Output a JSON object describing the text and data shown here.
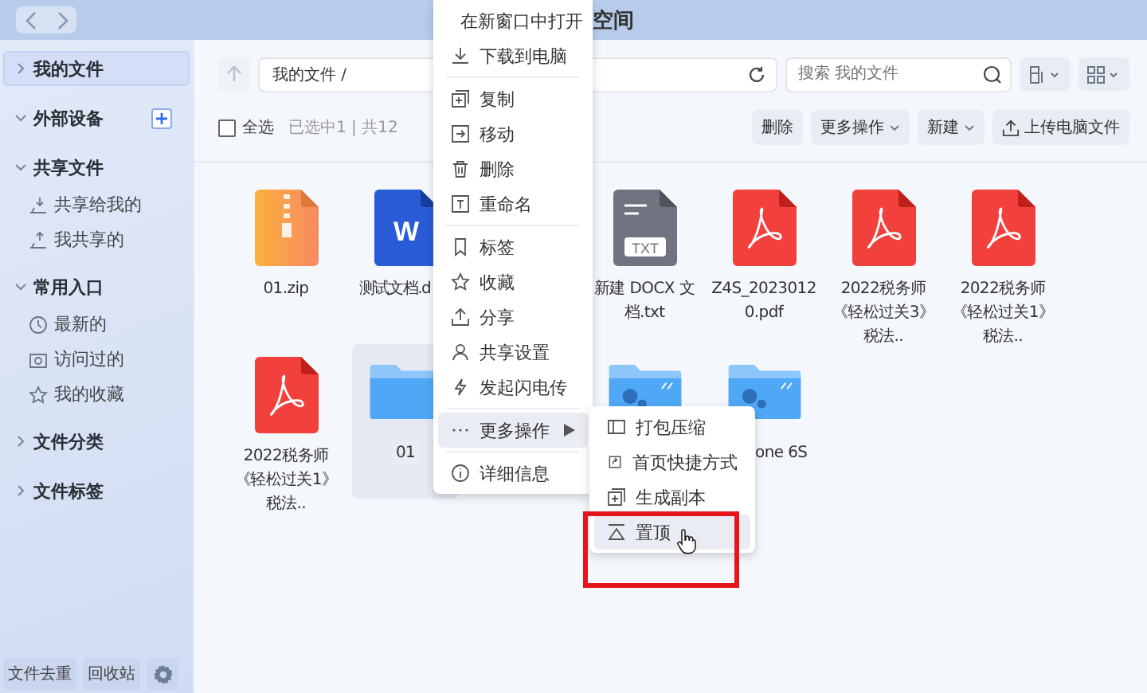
{
  "window": {
    "title": "空间"
  },
  "sidebar": {
    "sections": [
      {
        "label": "我的文件",
        "expanded": false,
        "selected": true
      },
      {
        "label": "外部设备",
        "expanded": true,
        "selected": false,
        "add_button": true
      },
      {
        "label": "共享文件",
        "expanded": true,
        "selected": false,
        "children": [
          {
            "label": "共享给我的"
          },
          {
            "label": "我共享的"
          }
        ]
      },
      {
        "label": "常用入口",
        "expanded": true,
        "selected": false,
        "children": [
          {
            "label": "最新的"
          },
          {
            "label": "访问过的"
          },
          {
            "label": "我的收藏"
          }
        ]
      },
      {
        "label": "文件分类",
        "expanded": false,
        "selected": false
      },
      {
        "label": "文件标签",
        "expanded": false,
        "selected": false
      }
    ],
    "footer_buttons": [
      "文件去重",
      "回收站"
    ]
  },
  "toolbar": {
    "path": "我的文件 /",
    "search": {
      "placeholder": "搜索 我的文件"
    }
  },
  "actions": {
    "select_all": {
      "label": "全选",
      "checked": false
    },
    "status": "已选中1 | 共12",
    "buttons": [
      {
        "kind": "plain",
        "label": "删除"
      },
      {
        "kind": "dropdown",
        "label": "更多操作"
      },
      {
        "kind": "dropdown",
        "label": "新建"
      },
      {
        "kind": "upload",
        "label": "上传电脑文件"
      }
    ]
  },
  "files": [
    [
      {
        "kind": "zip",
        "name": "01.zip",
        "selected": false
      },
      {
        "kind": "word",
        "icon_text": "W",
        "name": "测试文档.d",
        "selected": false
      },
      {
        "kind": "txt",
        "icon_text": "TXT",
        "name": "新建 DOCX 文档.txt",
        "selected": false
      },
      {
        "kind": "pdf",
        "name": "Z4S_20230120.pdf",
        "selected": false
      },
      {
        "kind": "pdf",
        "name": "2022税务师《轻松过关3》税法..",
        "selected": false
      },
      {
        "kind": "pdf",
        "name": "2022税务师《轻松过关1》税法..",
        "selected": false
      }
    ],
    [
      {
        "kind": "pdf",
        "name": "2022税务师《轻松过关1》税法..",
        "selected": false
      },
      {
        "kind": "folder",
        "name": "01",
        "selected": true
      },
      {
        "kind": "folder-gear",
        "selected": false
      },
      {
        "kind": "folder-gear",
        "name": "one 6S",
        "selected": false
      }
    ]
  ],
  "context_menu": [
    {
      "kind": "item",
      "label": "在新窗口中打开",
      "highlighted": false
    },
    {
      "kind": "item",
      "label": "下载到电脑",
      "highlighted": false
    },
    {
      "kind": "divider"
    },
    {
      "kind": "item",
      "label": "复制",
      "highlighted": false
    },
    {
      "kind": "item",
      "label": "移动",
      "highlighted": false
    },
    {
      "kind": "item",
      "label": "删除",
      "highlighted": false
    },
    {
      "kind": "item",
      "label": "重命名",
      "highlighted": false
    },
    {
      "kind": "divider"
    },
    {
      "kind": "item",
      "label": "标签",
      "highlighted": false
    },
    {
      "kind": "item",
      "label": "收藏",
      "highlighted": false
    },
    {
      "kind": "item",
      "label": "分享",
      "highlighted": false
    },
    {
      "kind": "item",
      "label": "共享设置",
      "highlighted": false
    },
    {
      "kind": "item",
      "label": "发起闪电传",
      "highlighted": false
    },
    {
      "kind": "divider"
    },
    {
      "kind": "submenu",
      "label": "更多操作",
      "highlighted": true
    },
    {
      "kind": "divider"
    },
    {
      "kind": "item",
      "label": "详细信息",
      "highlighted": false
    }
  ],
  "submenu": [
    {
      "label": "打包压缩",
      "highlighted": false
    },
    {
      "label": "首页快捷方式",
      "highlighted": false
    },
    {
      "label": "生成副本",
      "highlighted": false
    },
    {
      "label": "置顶",
      "highlighted": true
    }
  ]
}
